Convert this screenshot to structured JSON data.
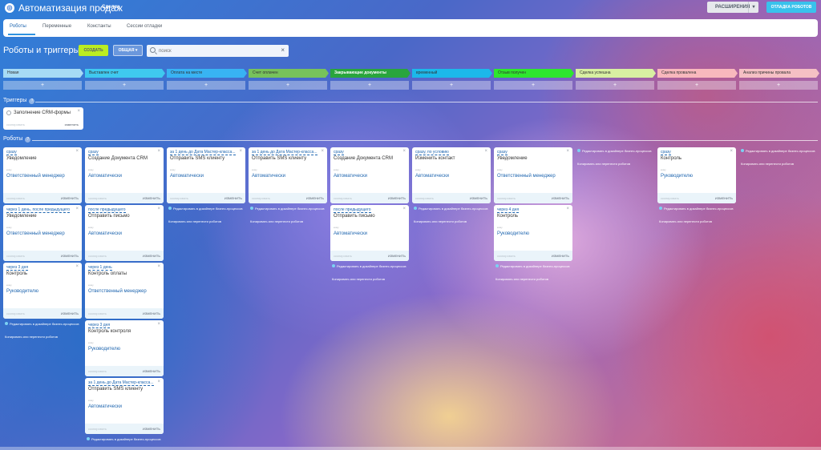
{
  "header": {
    "logo": "◎",
    "title": "Автоматизация продаж",
    "subtitle": "Сделки",
    "extensions_label": "РАСШИРЕНИЯ",
    "debug_label": "ОТЛАДКА РОБОТОВ"
  },
  "tabs": [
    "Роботы",
    "Переменные",
    "Константы",
    "Сессии отладки"
  ],
  "toolbar": {
    "page_title": "Роботы и триггеры",
    "create_label": "СОЗДАТЬ",
    "general_label": "ОБЩАЯ",
    "search_placeholder": "поиск"
  },
  "stages": [
    {
      "label": "Новая",
      "color": "#a6dbf5"
    },
    {
      "label": "Выставлен счет",
      "color": "#3fc9ef"
    },
    {
      "label": "Оплата на месте",
      "color": "#38b3f3"
    },
    {
      "label": "Счет оплачен",
      "color": "#77c25b"
    },
    {
      "label": "Закрывающие документы",
      "color": "#29a53d"
    },
    {
      "label": "временный",
      "color": "#1cb8ea"
    },
    {
      "label": "Отзыв получен",
      "color": "#2ee62e"
    },
    {
      "label": "Сделка успешна",
      "color": "#d8f0a2"
    },
    {
      "label": "Сделка провалена",
      "color": "#f8b8bd"
    },
    {
      "label": "Анализ причины провала",
      "color": "#f5c0c4"
    }
  ],
  "sections": {
    "triggers_label": "Триггеры",
    "robots_label": "Роботы"
  },
  "trigger": {
    "name": "Заполнение CRM-формы",
    "copy_label": "скопировать",
    "edit_label": "изменить"
  },
  "labels": {
    "resp_label": "кому",
    "copy": "скопировать",
    "edit": "ИЗМЕНИТЬ",
    "add": "+",
    "close": "×",
    "bp_designer": "Редактировать в дизайнере бизнес-процессов",
    "copy_move": "Копировать или перенести роботов"
  },
  "columns": [
    {
      "robots": [
        {
          "cond": "сразу",
          "name": "Уведомление",
          "resp": "Ответственный менеджер"
        },
        {
          "cond": "через 1 день, после предыдущего",
          "name": "Уведомление",
          "resp": "Ответственный менеджер"
        },
        {
          "cond": "через 3 дня",
          "name": "Контроль",
          "resp": "Руководителю"
        }
      ]
    },
    {
      "robots": [
        {
          "cond": "сразу",
          "name": "Создание Документа CRM",
          "resp": "Автоматически"
        },
        {
          "cond": "после предыдущего",
          "name": "Отправить письмо",
          "resp": "Автоматически"
        },
        {
          "cond": "через 1 день",
          "name": "Контроль оплаты",
          "resp": "Ответственный менеджер"
        },
        {
          "cond": "через 3 дня",
          "name": "Контроль контроля",
          "resp": "Руководителю"
        },
        {
          "cond": "за 1 день до Дата Мастер-класса...",
          "name": "Отправить SMS клиенту",
          "resp": "Автоматически"
        }
      ]
    },
    {
      "robots": [
        {
          "cond": "за 1 день до Дата Мастер-класса...",
          "name": "Отправить SMS клиенту",
          "resp": "Автоматически"
        }
      ]
    },
    {
      "robots": [
        {
          "cond": "за 1 день до Дата Мастер-класса...",
          "name": "Отправить SMS клиенту",
          "resp": "Автоматически"
        }
      ]
    },
    {
      "robots": [
        {
          "cond": "сразу",
          "name": "Создание Документа CRM",
          "resp": "Автоматически"
        },
        {
          "cond": "после предыдущего",
          "name": "Отправить письмо",
          "resp": "Автоматически"
        }
      ]
    },
    {
      "robots": [
        {
          "cond": "сразу, по условию",
          "name": "Изменить контакт",
          "resp": "Автоматически"
        }
      ]
    },
    {
      "robots": [
        {
          "cond": "сразу",
          "name": "Уведомление",
          "resp": "Ответственный менеджер"
        },
        {
          "cond": "через 4 дня",
          "name": "Контроль",
          "resp": "Руководителю"
        }
      ]
    },
    {
      "robots": []
    },
    {
      "robots": [
        {
          "cond": "сразу",
          "name": "Контроль",
          "resp": "Руководителю"
        }
      ]
    },
    {
      "robots": []
    }
  ]
}
